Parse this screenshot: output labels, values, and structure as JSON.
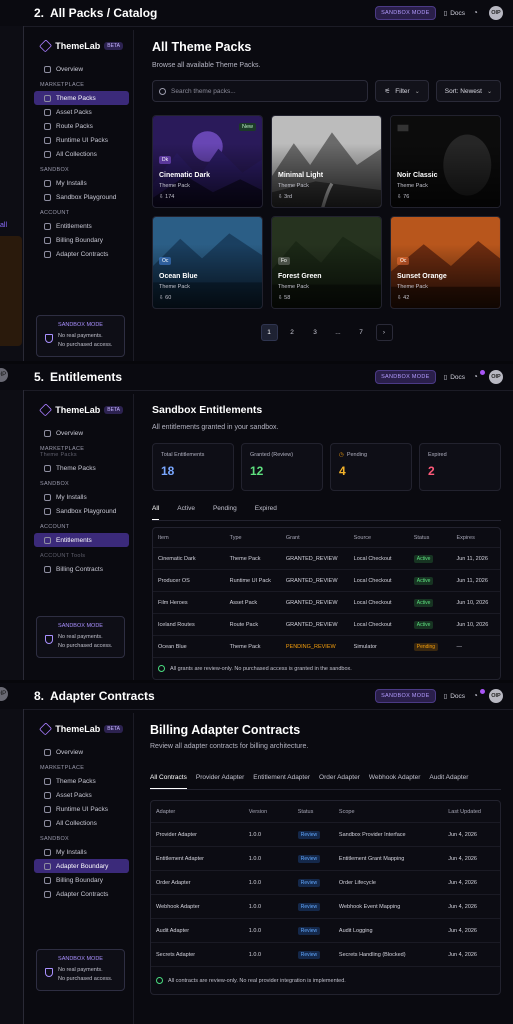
{
  "global": {
    "sandbox_label": "SANDBOX MODE",
    "docs_label": "Docs",
    "avatar_initials": "OIP",
    "brand": "ThemeLab",
    "beta": "BETA",
    "sandbox_box_title": "SANDBOX MODE",
    "sandbox_box_line1": "No real payments.",
    "sandbox_box_line2": "No purchased access.",
    "colors": {
      "accent": "#8b5cf6",
      "active_nav": "#3b2a7a",
      "active_green": "#5ee07f",
      "pending_amber": "#f59e0b",
      "review_blue": "#60a5fa"
    }
  },
  "panel1": {
    "step": "2.",
    "title": "All Packs / Catalog",
    "ghost_text": "all",
    "nav": {
      "overview": "Overview",
      "section_marketplace": "MARKETPLACE",
      "theme_packs": "Theme Packs",
      "asset_packs": "Asset Packs",
      "route_packs": "Route Packs",
      "runtime_ui_packs": "Runtime UI Packs",
      "all_collections": "All Collections",
      "section_sandbox": "SANDBOX",
      "my_installs": "My Installs",
      "sandbox_playground": "Sandbox Playground",
      "section_account": "ACCOUNT",
      "entitlements": "Entitlements",
      "billing_boundary": "Billing Boundary",
      "adapter_contracts": "Adapter Contracts"
    },
    "heading": "All Theme Packs",
    "subheading": "Browse all available Theme Packs.",
    "search_placeholder": "Search theme packs...",
    "filter_label": "Filter",
    "sort_label": "Sort: Newest",
    "cards": [
      {
        "name": "Cinematic Dark",
        "kind": "Theme Pack",
        "count": "174",
        "badge": "New",
        "chip": "Dk"
      },
      {
        "name": "Minimal Light",
        "kind": "Theme Pack",
        "count": "3rd",
        "badge": "",
        "chip": ""
      },
      {
        "name": "Noir Classic",
        "kind": "Theme Pack",
        "count": "76",
        "badge": "",
        "chip": ""
      },
      {
        "name": "Ocean Blue",
        "kind": "Theme Pack",
        "count": "60",
        "badge": "",
        "chip": "Oc"
      },
      {
        "name": "Forest Green",
        "kind": "Theme Pack",
        "count": "58",
        "badge": "",
        "chip": "Fo"
      },
      {
        "name": "Sunset Orange",
        "kind": "Theme Pack",
        "count": "42",
        "badge": "",
        "chip": "Oc"
      }
    ],
    "pager": [
      "1",
      "2",
      "3",
      "...",
      "7",
      "›"
    ]
  },
  "panel2": {
    "step": "5.",
    "title": "Entitlements",
    "nav": {
      "overview": "Overview",
      "section_marketplace": "MARKETPLACE",
      "theme_packs_ghost": "Theme Packs",
      "theme_packs": "Theme Packs",
      "section_sandbox": "SANDBOX",
      "my_installs": "My Installs",
      "sandbox_playground": "Sandbox Playground",
      "section_account": "ACCOUNT",
      "entitlements": "Entitlements",
      "account_ghost": "ACCOUNT Tools",
      "billing_boundary": "Billing Contracts"
    },
    "heading": "Sandbox Entitlements",
    "subheading": "All entitlements granted in your sandbox.",
    "stats": [
      {
        "label": "Total Entitlements",
        "value": "18"
      },
      {
        "label": "Granted (Review)",
        "value": "12"
      },
      {
        "label": "Pending",
        "value": "4"
      },
      {
        "label": "Expired",
        "value": "2"
      }
    ],
    "tabs": [
      "All",
      "Active",
      "Pending",
      "Expired"
    ],
    "columns": [
      "Item",
      "Type",
      "Grant",
      "Source",
      "Status",
      "Expires"
    ],
    "rows": [
      [
        "Cinematic Dark",
        "Theme Pack",
        "GRANTED_REVIEW",
        "Local Checkout",
        "Active",
        "Jun 11, 2026"
      ],
      [
        "Producer OS",
        "Runtime UI Pack",
        "GRANTED_REVIEW",
        "Local Checkout",
        "Active",
        "Jun 11, 2026"
      ],
      [
        "Film Heroes",
        "Asset Pack",
        "GRANTED_REVIEW",
        "Local Checkout",
        "Active",
        "Jun 10, 2026"
      ],
      [
        "Iceland Routes",
        "Route Pack",
        "GRANTED_REVIEW",
        "Local Checkout",
        "Active",
        "Jun 10, 2026"
      ],
      [
        "Ocean Blue",
        "Theme Pack",
        "PENDING_REVIEW",
        "Simulator",
        "Pending",
        "—"
      ]
    ],
    "note": "All grants are review-only. No purchased access is granted in the sandbox."
  },
  "panel3": {
    "step": "8.",
    "title": "Adapter Contracts",
    "nav": {
      "overview": "Overview",
      "section_marketplace": "MARKETPLACE",
      "theme_packs": "Theme Packs",
      "asset_packs": "Asset Packs",
      "runtime_ui_packs": "Runtime UI Packs",
      "all_collections": "All Collections",
      "section_sandbox": "SANDBOX",
      "my_installs": "My Installs",
      "adapter_boundary": "Adapter Boundary",
      "billing_boundary": "Billing Boundary",
      "adapter_contracts": "Adapter Contracts"
    },
    "heading": "Billing Adapter Contracts",
    "subheading": "Review all adapter contracts for billing architecture.",
    "tabs": [
      "All Contracts",
      "Provider Adapter",
      "Entitlement Adapter",
      "Order Adapter",
      "Webhook Adapter",
      "Audit Adapter"
    ],
    "columns": [
      "Adapter",
      "Version",
      "Status",
      "Scope",
      "Last Updated"
    ],
    "rows": [
      [
        "Provider Adapter",
        "1.0.0",
        "Review",
        "Sandbox Provider Interface",
        "Jun 4, 2026"
      ],
      [
        "Entitlement Adapter",
        "1.0.0",
        "Review",
        "Entitlement Grant Mapping",
        "Jun 4, 2026"
      ],
      [
        "Order Adapter",
        "1.0.0",
        "Review",
        "Order Lifecycle",
        "Jun 4, 2026"
      ],
      [
        "Webhook Adapter",
        "1.0.0",
        "Review",
        "Webhook Event Mapping",
        "Jun 4, 2026"
      ],
      [
        "Audit Adapter",
        "1.0.0",
        "Review",
        "Audit Logging",
        "Jun 4, 2026"
      ],
      [
        "Secrets Adapter",
        "1.0.0",
        "Review",
        "Secrets Handling (Blocked)",
        "Jun 4, 2026"
      ]
    ],
    "note": "All contracts are review-only. No real provider integration is implemented."
  }
}
